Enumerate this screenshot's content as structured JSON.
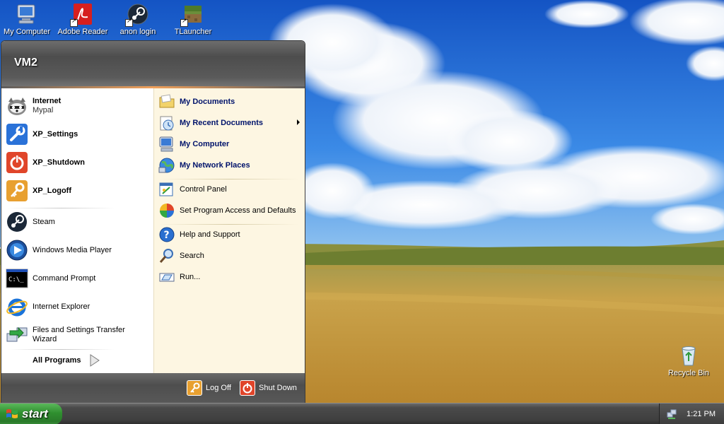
{
  "desktop": {
    "icons": [
      {
        "label": "My Computer",
        "icon": "my-computer-icon"
      },
      {
        "label": "Adobe Reader",
        "icon": "adobe-reader-icon"
      },
      {
        "label": "anon login",
        "icon": "steam-icon"
      },
      {
        "label": "TLauncher",
        "icon": "tlauncher-icon"
      },
      {
        "label": "Recycle Bin",
        "icon": "recycle-bin-icon"
      }
    ]
  },
  "start_menu": {
    "user_name": "VM2",
    "pinned": [
      {
        "title": "Internet",
        "subtitle": "Mypal",
        "icon": "mypal-icon"
      },
      {
        "title": "XP_Settings",
        "icon": "wrench-icon"
      },
      {
        "title": "XP_Shutdown",
        "icon": "power-icon"
      },
      {
        "title": "XP_Logoff",
        "icon": "key-icon"
      }
    ],
    "recent": [
      {
        "label": "Steam",
        "icon": "steam-icon"
      },
      {
        "label": "Windows Media Player",
        "icon": "media-player-icon"
      },
      {
        "label": "Command Prompt",
        "icon": "command-prompt-icon"
      },
      {
        "label": "Internet Explorer",
        "icon": "internet-explorer-icon"
      },
      {
        "label": "Files and Settings Transfer Wizard",
        "icon": "transfer-wizard-icon"
      }
    ],
    "all_programs": "All Programs",
    "places": [
      {
        "label": "My Documents",
        "icon": "folder-icon"
      },
      {
        "label": "My Recent Documents",
        "icon": "recent-documents-icon"
      },
      {
        "label": "My Computer",
        "icon": "my-computer-icon"
      },
      {
        "label": "My Network Places",
        "icon": "network-places-icon"
      }
    ],
    "settings": [
      {
        "label": "Control Panel",
        "icon": "control-panel-icon"
      },
      {
        "label": "Set Program Access and Defaults",
        "icon": "program-defaults-icon"
      }
    ],
    "help": [
      {
        "label": "Help and Support",
        "icon": "help-icon"
      },
      {
        "label": "Search",
        "icon": "search-icon"
      },
      {
        "label": "Run...",
        "icon": "run-icon"
      }
    ],
    "footer": {
      "log_off": "Log Off",
      "shut_down": "Shut Down"
    }
  },
  "taskbar": {
    "start_label": "start",
    "clock": "1:21 PM"
  },
  "colors": {
    "sky": "#1f6fd6",
    "field": "#c9a24a",
    "menu_header": "#5a5a5a",
    "menu_right_panel": "#fdf6e2",
    "start_button": "#2f8f2f"
  }
}
